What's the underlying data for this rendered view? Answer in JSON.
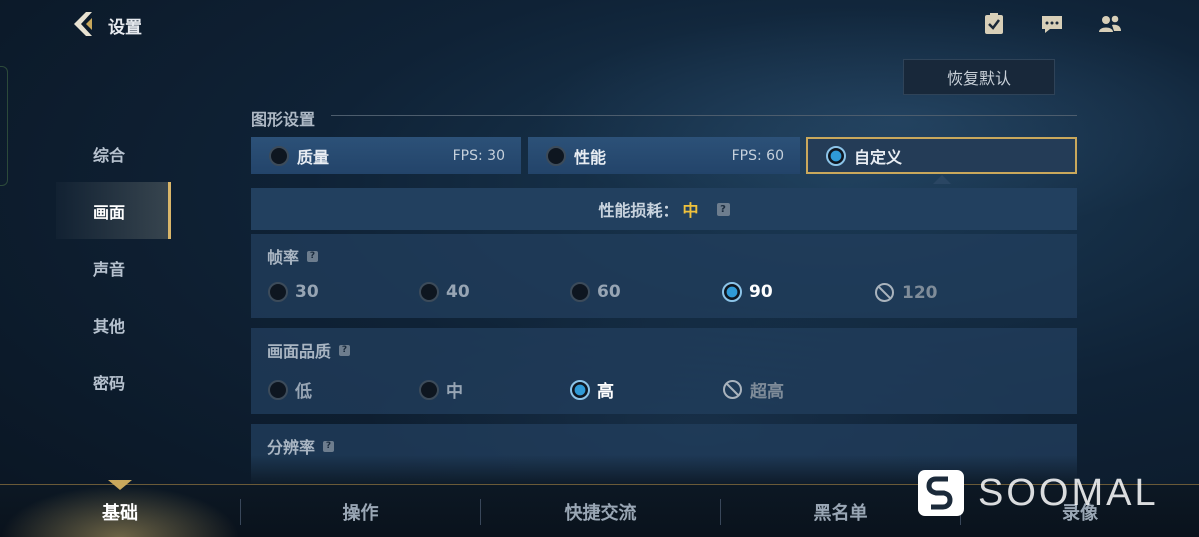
{
  "header": {
    "title": "设置",
    "restore_label": "恢复默认",
    "icons": [
      "task-icon",
      "chat-icon",
      "friends-icon"
    ]
  },
  "sidebar": {
    "items": [
      {
        "label": "综合",
        "active": false
      },
      {
        "label": "画面",
        "active": true
      },
      {
        "label": "声音",
        "active": false
      },
      {
        "label": "其他",
        "active": false
      },
      {
        "label": "密码",
        "active": false
      }
    ]
  },
  "graphics": {
    "section_title": "图形设置",
    "presets": [
      {
        "label": "质量",
        "fps": "FPS: 30",
        "selected": false
      },
      {
        "label": "性能",
        "fps": "FPS: 60",
        "selected": false
      },
      {
        "label": "自定义",
        "fps": "",
        "selected": true
      }
    ],
    "perf_label": "性能损耗：",
    "perf_value": "中",
    "help_glyph": "?"
  },
  "frame_rate": {
    "title": "帧率",
    "options": [
      {
        "label": "30",
        "state": "off"
      },
      {
        "label": "40",
        "state": "off"
      },
      {
        "label": "60",
        "state": "off"
      },
      {
        "label": "90",
        "state": "on"
      },
      {
        "label": "120",
        "state": "disabled"
      }
    ]
  },
  "quality": {
    "title": "画面品质",
    "options": [
      {
        "label": "低",
        "state": "off"
      },
      {
        "label": "中",
        "state": "off"
      },
      {
        "label": "高",
        "state": "on"
      },
      {
        "label": "超高",
        "state": "disabled"
      }
    ]
  },
  "resolution": {
    "title": "分辨率"
  },
  "bottom_tabs": [
    {
      "label": "基础",
      "active": true
    },
    {
      "label": "操作",
      "active": false
    },
    {
      "label": "快捷交流",
      "active": false
    },
    {
      "label": "黑名单",
      "active": false
    },
    {
      "label": "录像",
      "active": false
    }
  ],
  "watermark": {
    "text": "SOOMAL"
  },
  "colors": {
    "accent_gold": "#c9a85c",
    "value_yellow": "#f0c23c",
    "radio_on": "#2f9ad6"
  }
}
